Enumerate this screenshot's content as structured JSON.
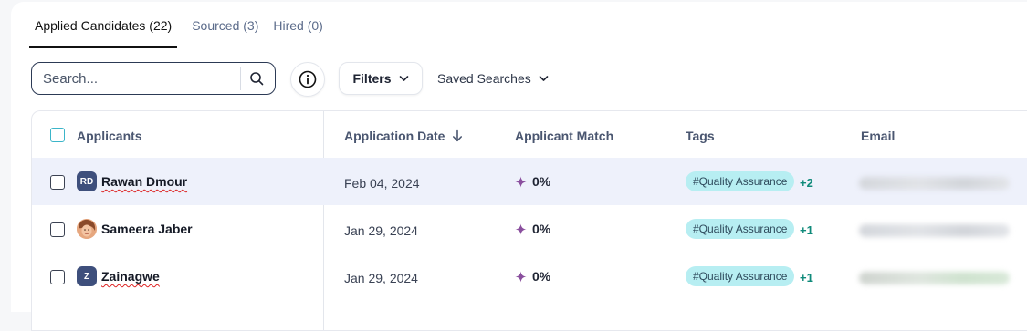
{
  "tabs": [
    {
      "label": "Applied Candidates (22)",
      "active": true
    },
    {
      "label": "Sourced (3)",
      "active": false
    },
    {
      "label": "Hired (0)",
      "active": false
    }
  ],
  "toolbar": {
    "search_placeholder": "Search...",
    "filters_label": "Filters",
    "saved_searches_label": "Saved Searches"
  },
  "table": {
    "headers": {
      "applicants": "Applicants",
      "application_date": "Application Date",
      "applicant_match": "Applicant Match",
      "tags": "Tags",
      "email": "Email"
    },
    "sort": {
      "column": "application_date",
      "direction": "descending"
    },
    "rows": [
      {
        "initials": "RD",
        "avatar_type": "initials",
        "name": "Rawan Dmour",
        "date": "Feb 04, 2024",
        "match": "0%",
        "tag": "#Quality Assurance",
        "more_tags": "+2",
        "email_blurred": true,
        "selected": true
      },
      {
        "initials": "",
        "avatar_type": "photo",
        "name": "Sameera Jaber",
        "date": "Jan 29, 2024",
        "match": "0%",
        "tag": "#Quality Assurance",
        "more_tags": "+1",
        "email_blurred": true,
        "selected": false
      },
      {
        "initials": "Z",
        "avatar_type": "initials",
        "name": "Zainagwe",
        "date": "Jan 29, 2024",
        "match": "0%",
        "tag": "#Quality Assurance",
        "more_tags": "+1",
        "email_blurred": true,
        "selected": false
      }
    ]
  },
  "colors": {
    "accent_teal": "#3bb5c9",
    "tag_bg": "#b7eef2",
    "more_tags": "#0f8a7a",
    "avatar_bg": "#3e4f7c",
    "selected_row": "#eef1fb",
    "sparkle": "#8a4f9e"
  }
}
